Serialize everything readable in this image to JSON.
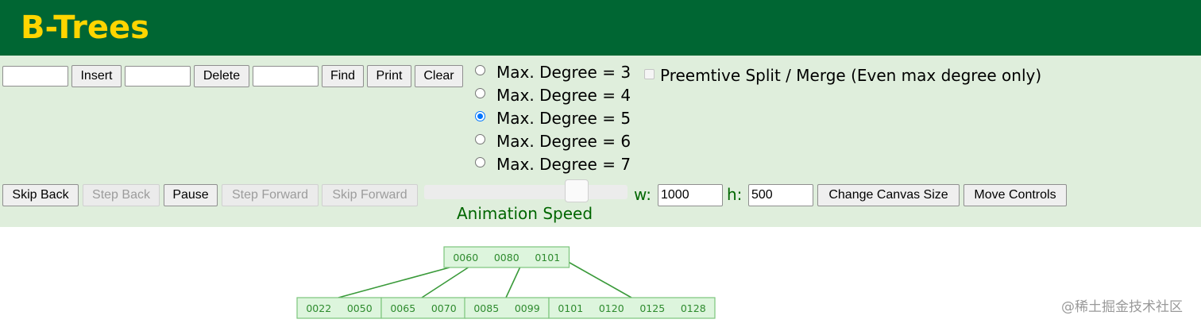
{
  "header": {
    "title": "B-Trees"
  },
  "toolbar": {
    "insert_value": "",
    "insert_label": "Insert",
    "delete_value": "",
    "delete_label": "Delete",
    "find_value": "",
    "find_label": "Find",
    "print_label": "Print",
    "clear_label": "Clear"
  },
  "degree_options": [
    {
      "label": "Max. Degree = 3",
      "checked": false
    },
    {
      "label": "Max. Degree = 4",
      "checked": false
    },
    {
      "label": "Max. Degree = 5",
      "checked": true
    },
    {
      "label": "Max. Degree = 6",
      "checked": false
    },
    {
      "label": "Max. Degree = 7",
      "checked": false
    }
  ],
  "preemptive": {
    "label": "Preemtive Split / Merge (Even max degree only)",
    "checked": false,
    "enabled": false
  },
  "playback": {
    "skip_back": "Skip Back",
    "step_back": "Step Back",
    "pause": "Pause",
    "step_forward": "Step Forward",
    "skip_forward": "Skip Forward"
  },
  "animation": {
    "label": "Animation Speed",
    "speed_fraction": 0.75
  },
  "canvas_size": {
    "w_label": "w:",
    "w_value": "1000",
    "h_label": "h:",
    "h_value": "500",
    "change_label": "Change Canvas Size",
    "move_label": "Move Controls"
  },
  "tree": {
    "root": [
      "0060",
      "0080",
      "0101"
    ],
    "children": [
      [
        "0022",
        "0050"
      ],
      [
        "0065",
        "0070"
      ],
      [
        "0085",
        "0099"
      ],
      [
        "0101",
        "0120",
        "0125",
        "0128"
      ]
    ],
    "node_fill": "#ddf5dd",
    "node_stroke": "#7cc47c",
    "text_color": "#2e8b2e",
    "edge_color": "#3a9a3a"
  },
  "watermark": "@稀土掘金技术社区"
}
